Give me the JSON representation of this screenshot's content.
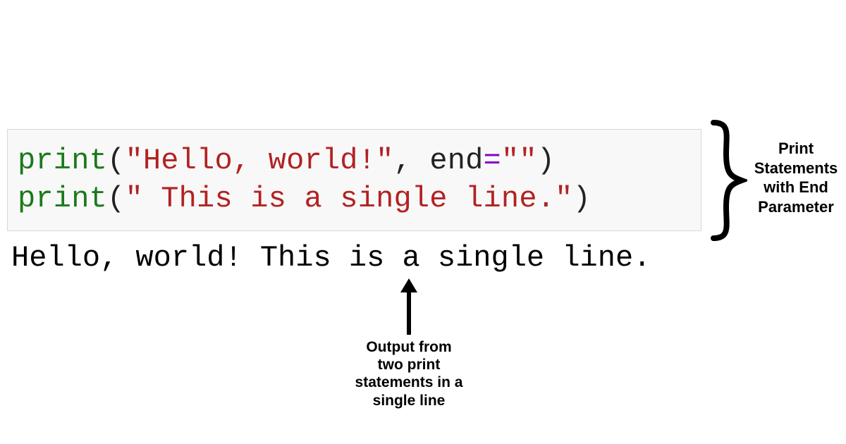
{
  "code": {
    "line1": {
      "func": "print",
      "open": "(",
      "str": "\"Hello, world!\"",
      "comma": ", ",
      "kw": "end",
      "op": "=",
      "strB": "\"\"",
      "close": ")"
    },
    "line2": {
      "func": "print",
      "open": "(",
      "str": "\" This is a single line.\"",
      "close": ")"
    }
  },
  "output": "Hello, world! This is a single line.",
  "labels": {
    "right": "Print Statements with End Parameter",
    "bottom": "Output from two print statements in a single line"
  },
  "colors": {
    "codeBg": "#f8f8f8",
    "codeBorder": "#d8d8d8",
    "func": "#1a7a1a",
    "string": "#b22222",
    "operator": "#8800cc",
    "text": "#000000"
  }
}
